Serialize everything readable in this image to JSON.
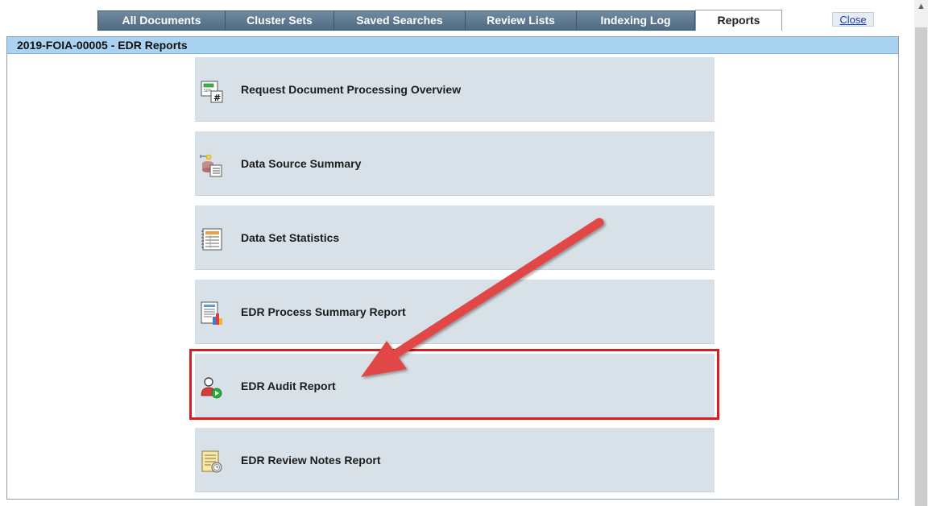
{
  "tabs": [
    {
      "label": "All Documents",
      "active": false
    },
    {
      "label": "Cluster Sets",
      "active": false
    },
    {
      "label": "Saved Searches",
      "active": false
    },
    {
      "label": "Review Lists",
      "active": false
    },
    {
      "label": "Indexing Log",
      "active": false
    },
    {
      "label": "Reports",
      "active": true
    }
  ],
  "close_link": "Close",
  "panel": {
    "title": "2019-FOIA-00005 - EDR Reports"
  },
  "reports": [
    {
      "label": "Request Document Processing Overview",
      "icon": "processing-overview-icon"
    },
    {
      "label": "Data Source Summary",
      "icon": "data-source-icon"
    },
    {
      "label": "Data Set Statistics",
      "icon": "statistics-sheet-icon"
    },
    {
      "label": "EDR Process Summary Report",
      "icon": "summary-chart-icon"
    },
    {
      "label": "EDR Audit Report",
      "icon": "audit-user-icon",
      "highlighted": true
    },
    {
      "label": "EDR Review Notes Report",
      "icon": "review-notes-icon"
    }
  ],
  "colors": {
    "tab_bg": "#5b768d",
    "panel_header_bg": "#a9d3f0",
    "report_item_bg": "#d7e1e7",
    "highlight": "#d81e1e",
    "arrow": "#e04040"
  }
}
